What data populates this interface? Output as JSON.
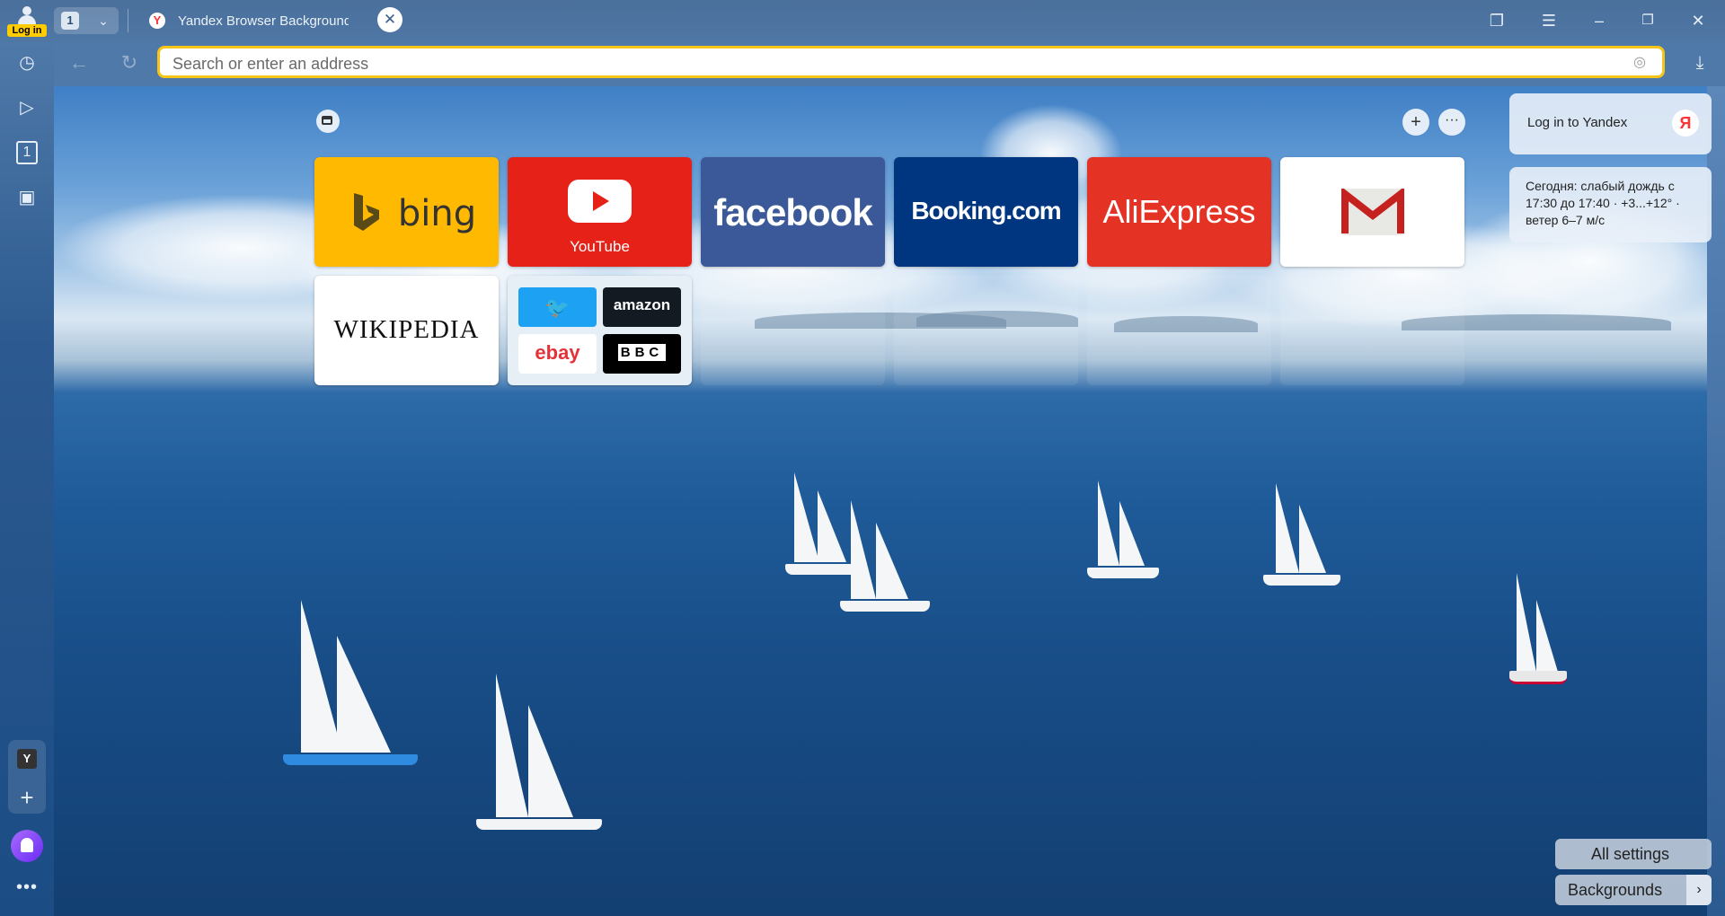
{
  "browser": {
    "login_badge": "Log in",
    "tab_count": "1",
    "tab_title": "Yandex Browser Backgrounds",
    "favicon_letter": "Y",
    "address_placeholder": "Search or enter an address"
  },
  "sidebar": {
    "tab_counter": "1",
    "bottom_letter": "Y",
    "more": "•••"
  },
  "tablo": {
    "tiles": [
      {
        "name": "bing",
        "label": "bing"
      },
      {
        "name": "youtube",
        "label": "YouTube"
      },
      {
        "name": "facebook",
        "label": "facebook"
      },
      {
        "name": "booking",
        "label": "Booking.com"
      },
      {
        "name": "aliexpress",
        "label": "AliExpress"
      },
      {
        "name": "gmail",
        "label": "M"
      },
      {
        "name": "wikipedia",
        "label": "WIKIPEDIA"
      }
    ],
    "folder": [
      "twitter",
      "amazon",
      "ebay",
      "BBC"
    ]
  },
  "widgets": {
    "login": "Log in to Yandex",
    "ya_letter": "Я",
    "weather": "Сегодня: слабый дождь с 17:30 до 17:40 · +3...+12° · ветер 6–7 м/с"
  },
  "buttons": {
    "all_settings": "All settings",
    "backgrounds": "Backgrounds"
  },
  "colors": {
    "accent": "#f5c518",
    "bing": "#ffb900",
    "youtube": "#e62117",
    "facebook": "#3b5998",
    "booking": "#003580",
    "aliexpress": "#e43225"
  }
}
